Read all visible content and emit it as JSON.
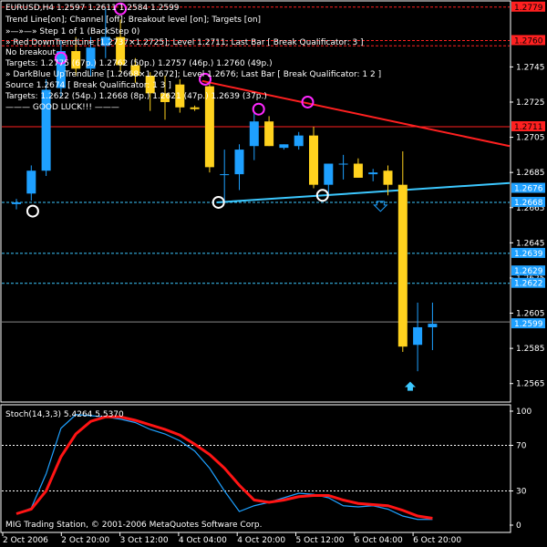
{
  "header": {
    "symbol_line": "EURUSD,H4  1.2597 1.2611 1.2584 1.2599",
    "settings_line": "Trend Line[on]; Channel [off]; Breakout level [on]; Targets [on]",
    "step_line": "»—»—» Step 1 of 1 (BackStep 0)",
    "red_line": "» Red DownTrendLine [1.2737×1.2725]; Level 1.2711; Last Bar [ Break Qualificator: 3 ]",
    "no_breakout": "No breakout",
    "targets_red": "Targets: 1.2775 (67p.) 1.2762 (50p.) 1.2757 (46p.) 1.2760 (49p.)",
    "blue_line": "» DarkBlue UpTrendLine [1.2668×1.2672]; Level 1.2676; Last Bar [ Break Qualificator: 1 2 ]",
    "source_line": "Source 1.2674 [ Break Qualificator: 1 3 ]",
    "targets_blue": "Targets: 1.2622 (54p.) 1.2668 (8p.) 1.2621 (47p.) 1.2639 (37p.)",
    "good_luck": "——— GOOD LUCK!!! ———"
  },
  "footer": {
    "copyright": "MIG Trading Station, © 2001-2006 MetaQuotes Software Corp."
  },
  "oscillator": {
    "label": "Stoch(14,3,3) 5.4264 5.5370",
    "levels": [
      "100",
      "70",
      "30",
      "0"
    ]
  },
  "colors": {
    "background": "#000000",
    "grid": "#ffffff",
    "bull": "#1ea0ff",
    "bear": "#ffd21e",
    "red_trend": "#ff2020",
    "blue_trend": "#3cc8ff",
    "marker_magenta": "#ff28ff",
    "marker_white": "#ffffff",
    "stoch_main": "#1ea0ff",
    "stoch_signal": "#ff1414"
  },
  "chart_data": {
    "type": "candlestick",
    "ylim": [
      1.2555,
      1.2782
    ],
    "x_tick_labels": [
      "2 Oct 2006",
      "2 Oct 20:00",
      "3 Oct 12:00",
      "4 Oct 04:00",
      "4 Oct 20:00",
      "5 Oct 12:00",
      "6 Oct 04:00",
      "6 Oct 20:00"
    ],
    "y_tick_labels": [
      "1.2745",
      "1.2725",
      "1.2705",
      "1.2685",
      "1.2665",
      "1.2645",
      "1.2625",
      "1.2605",
      "1.2585",
      "1.2565"
    ],
    "price_badges": [
      {
        "value": "1.2779",
        "style": "red"
      },
      {
        "value": "1.2760",
        "style": "red"
      },
      {
        "value": "1.2711",
        "style": "red"
      },
      {
        "value": "1.2676",
        "style": "blue"
      },
      {
        "value": "1.2668",
        "style": "blue"
      },
      {
        "value": "1.2639",
        "style": "blue"
      },
      {
        "value": "1.2629",
        "style": "blue"
      },
      {
        "value": "1.2622",
        "style": "blue"
      },
      {
        "value": "1.2599",
        "style": "blue"
      }
    ],
    "horizontal_lines": [
      {
        "price": 1.2779,
        "style": "red_dash"
      },
      {
        "price": 1.276,
        "style": "red_dash"
      },
      {
        "price": 1.2757,
        "style": "red_dash"
      },
      {
        "price": 1.2711,
        "style": "red_solid"
      },
      {
        "price": 1.2668,
        "style": "blue_dash"
      },
      {
        "price": 1.2639,
        "style": "blue_dash"
      },
      {
        "price": 1.2622,
        "style": "blue_dash"
      },
      {
        "price": 1.26,
        "style": "gray_solid"
      }
    ],
    "candles": [
      {
        "o": 1.2667,
        "h": 1.267,
        "l": 1.2664,
        "c": 1.2668
      },
      {
        "o": 1.2673,
        "h": 1.2689,
        "l": 1.2669,
        "c": 1.2686
      },
      {
        "o": 1.2686,
        "h": 1.2738,
        "l": 1.2683,
        "c": 1.2732
      },
      {
        "o": 1.2733,
        "h": 1.276,
        "l": 1.2728,
        "c": 1.2754
      },
      {
        "o": 1.2754,
        "h": 1.2762,
        "l": 1.274,
        "c": 1.2744
      },
      {
        "o": 1.2744,
        "h": 1.2762,
        "l": 1.274,
        "c": 1.2756
      },
      {
        "o": 1.2757,
        "h": 1.2778,
        "l": 1.275,
        "c": 1.2762
      },
      {
        "o": 1.2762,
        "h": 1.2772,
        "l": 1.2742,
        "c": 1.2746
      },
      {
        "o": 1.2746,
        "h": 1.275,
        "l": 1.2736,
        "c": 1.274
      },
      {
        "o": 1.274,
        "h": 1.2742,
        "l": 1.272,
        "c": 1.273
      },
      {
        "o": 1.273,
        "h": 1.274,
        "l": 1.2715,
        "c": 1.2725
      },
      {
        "o": 1.2735,
        "h": 1.2738,
        "l": 1.2719,
        "c": 1.2722
      },
      {
        "o": 1.2722,
        "h": 1.2723,
        "l": 1.272,
        "c": 1.2721
      },
      {
        "o": 1.2734,
        "h": 1.2737,
        "l": 1.2685,
        "c": 1.2688
      },
      {
        "o": 1.2684,
        "h": 1.2698,
        "l": 1.2668,
        "c": 1.2684
      },
      {
        "o": 1.2684,
        "h": 1.2701,
        "l": 1.2675,
        "c": 1.2698
      },
      {
        "o": 1.27,
        "h": 1.2719,
        "l": 1.2692,
        "c": 1.2714
      },
      {
        "o": 1.2714,
        "h": 1.2717,
        "l": 1.27,
        "c": 1.27
      },
      {
        "o": 1.2699,
        "h": 1.2701,
        "l": 1.2698,
        "c": 1.2701
      },
      {
        "o": 1.27,
        "h": 1.2708,
        "l": 1.2698,
        "c": 1.2706
      },
      {
        "o": 1.2706,
        "h": 1.2711,
        "l": 1.2676,
        "c": 1.2678
      },
      {
        "o": 1.2678,
        "h": 1.269,
        "l": 1.2672,
        "c": 1.269
      },
      {
        "o": 1.269,
        "h": 1.2695,
        "l": 1.2681,
        "c": 1.269
      },
      {
        "o": 1.269,
        "h": 1.2693,
        "l": 1.2682,
        "c": 1.2682
      },
      {
        "o": 1.2684,
        "h": 1.2687,
        "l": 1.268,
        "c": 1.2685
      },
      {
        "o": 1.2686,
        "h": 1.2689,
        "l": 1.2672,
        "c": 1.2678
      },
      {
        "o": 1.2678,
        "h": 1.2697,
        "l": 1.2583,
        "c": 1.2586
      },
      {
        "o": 1.2587,
        "h": 1.2611,
        "l": 1.2572,
        "c": 1.2597
      },
      {
        "o": 1.2597,
        "h": 1.2611,
        "l": 1.2584,
        "c": 1.2599
      }
    ],
    "trend_lines": [
      {
        "name": "Red DownTrendLine",
        "from": {
          "bar": 12.5,
          "price": 1.2737
        },
        "to": {
          "bar": 45,
          "price": 1.27
        }
      },
      {
        "name": "DarkBlue UpTrendLine",
        "from": {
          "bar": 13.5,
          "price": 1.2668
        },
        "to": {
          "bar": 45,
          "price": 1.2679
        }
      }
    ],
    "markers": [
      {
        "type": "magenta_circle",
        "bar": 3,
        "price": 1.275
      },
      {
        "type": "magenta_circle",
        "bar": 7,
        "price": 1.2778
      },
      {
        "type": "magenta_circle",
        "bar": 12.7,
        "price": 1.2738
      },
      {
        "type": "magenta_circle",
        "bar": 16.3,
        "price": 1.2721
      },
      {
        "type": "magenta_circle",
        "bar": 19.6,
        "price": 1.2725
      },
      {
        "type": "white_circle",
        "bar": 1.1,
        "price": 1.2663
      },
      {
        "type": "white_circle",
        "bar": 13.6,
        "price": 1.2668
      },
      {
        "type": "white_circle",
        "bar": 20.6,
        "price": 1.2672
      },
      {
        "type": "down_arrow",
        "bar": 24.5,
        "price": 1.2666
      },
      {
        "type": "up_arrow",
        "bar": 26.5,
        "price": 1.2563
      }
    ],
    "stochastic": {
      "ylim": [
        0,
        100
      ],
      "levels": [
        100,
        70,
        30,
        0
      ],
      "main": [
        10,
        15,
        45,
        85,
        97,
        96,
        95,
        93,
        90,
        84,
        80,
        74,
        65,
        50,
        30,
        12,
        17,
        20,
        24,
        28,
        27,
        24,
        17,
        16,
        17,
        14,
        8,
        5,
        5
      ],
      "signal": [
        10,
        14,
        30,
        60,
        80,
        91,
        95,
        95,
        92,
        88,
        84,
        79,
        71,
        62,
        50,
        35,
        22,
        20,
        22,
        25,
        26,
        26,
        22,
        19,
        18,
        17,
        13,
        8,
        6
      ]
    }
  }
}
